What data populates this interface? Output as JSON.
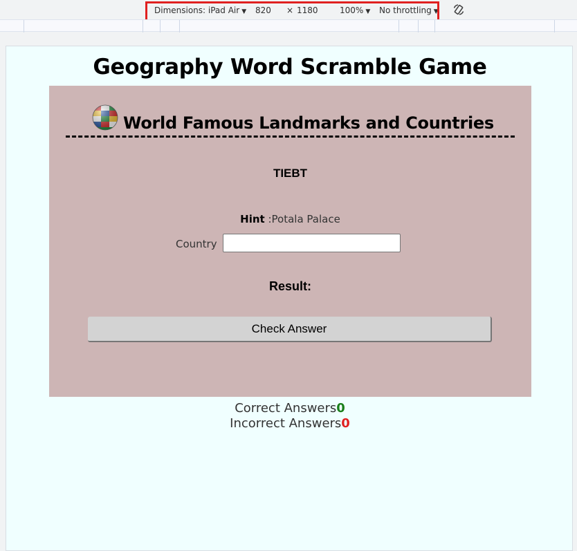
{
  "devtools": {
    "dimensions_label": "Dimensions: iPad Air",
    "width": "820",
    "times": "×",
    "height": "1180",
    "zoom": "100%",
    "throttling": "No throttling"
  },
  "page": {
    "title": "Geography Word Scramble Game",
    "card_heading": "World Famous Landmarks and Countries",
    "scrambled_word": "TIEBT",
    "hint_label": "Hint",
    "hint_separator": " :",
    "hint_value": "Potala Palace",
    "country_label": "Country",
    "country_value": "",
    "result_label": "Result:",
    "check_button": "Check Answer",
    "correct_label": "Correct Answers",
    "correct_count": "0",
    "incorrect_label": "Incorrect Answers",
    "incorrect_count": "0"
  },
  "colors": {
    "page_bg": "#f0ffff",
    "card_bg": "#cdb5b5",
    "correct": "#1a7f1a",
    "incorrect": "#e02020",
    "highlight_box": "#e02020"
  },
  "icons": {
    "globe": "globe-flags-icon",
    "rotate": "rotate-icon",
    "caret": "caret-down-icon"
  }
}
